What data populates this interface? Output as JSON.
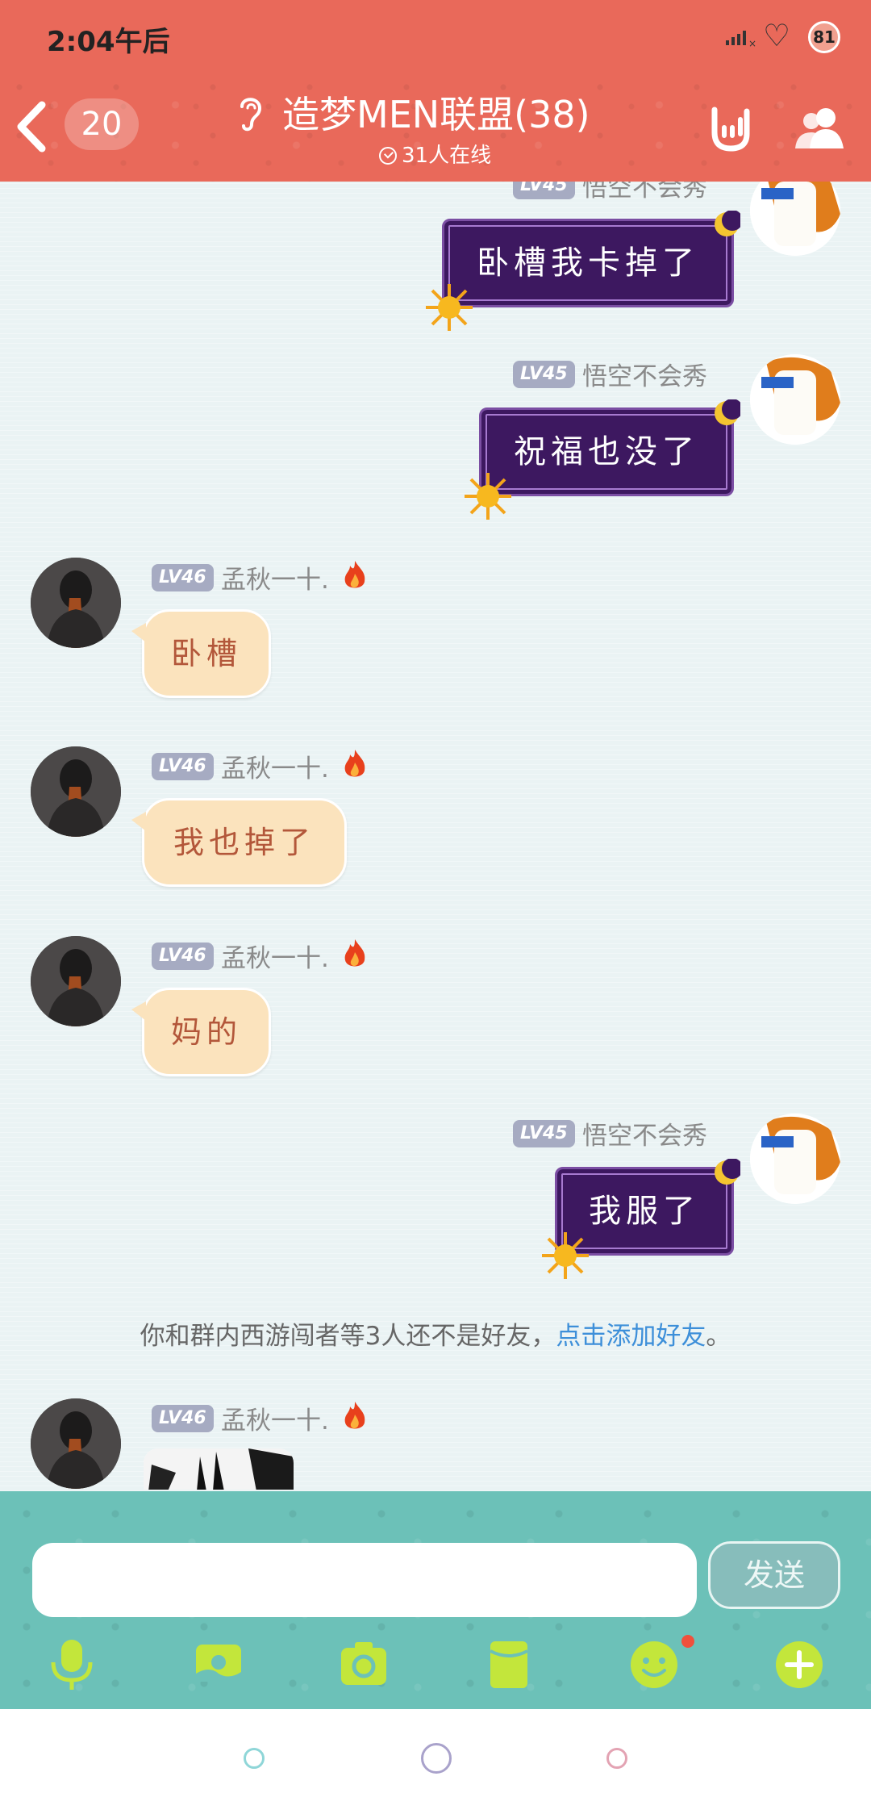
{
  "status_bar": {
    "time": "2:04午后",
    "battery": "81"
  },
  "header": {
    "unread_count": "20",
    "group_title": "造梦MEN联盟(38)",
    "online_text": "31人在线"
  },
  "messages": [
    {
      "sender": "悟空不会秀",
      "level": "LV45",
      "text": "卧槽我卡掉了",
      "side": "right"
    },
    {
      "sender": "悟空不会秀",
      "level": "LV45",
      "text": "祝福也没了",
      "side": "right"
    },
    {
      "sender": "孟秋一十.",
      "level": "LV46",
      "text": "卧槽",
      "side": "left"
    },
    {
      "sender": "孟秋一十.",
      "level": "LV46",
      "text": "我也掉了",
      "side": "left"
    },
    {
      "sender": "孟秋一十.",
      "level": "LV46",
      "text": "妈的",
      "side": "left"
    },
    {
      "sender": "悟空不会秀",
      "level": "LV45",
      "text": "我服了",
      "side": "right"
    },
    {
      "sender": "孟秋一十.",
      "level": "LV46",
      "text": "",
      "side": "left"
    }
  ],
  "system_notice": {
    "text": "你和群内西游闯者等3人还不是好友，",
    "link": "点击添加好友",
    "end": "。"
  },
  "input_bar": {
    "value": "",
    "send_label": "发送",
    "tools": [
      "microphone-icon",
      "picture-icon",
      "camera-icon",
      "red-packet-icon",
      "emoji-icon",
      "plus-icon"
    ]
  },
  "colors": {
    "header": "#e9695a",
    "input_bar": "#6cc1b8",
    "purple_bubble": "#3d1860",
    "cream_bubble": "#fbe3bd",
    "link": "#3d8fd9"
  }
}
